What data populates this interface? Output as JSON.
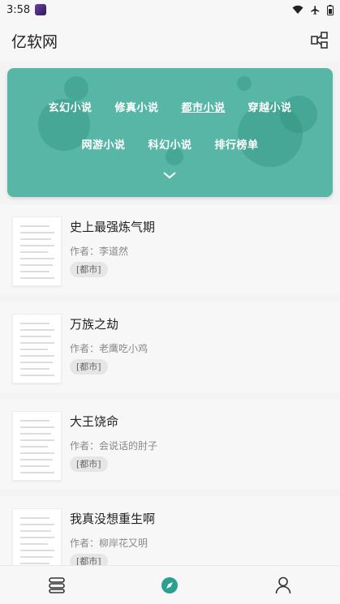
{
  "status": {
    "time": "3:58"
  },
  "app": {
    "title": "亿软网"
  },
  "categories": {
    "row1": [
      "玄幻小说",
      "修真小说",
      "都市小说",
      "穿越小说"
    ],
    "row2": [
      "网游小说",
      "科幻小说",
      "排行榜单"
    ],
    "active": "都市小说"
  },
  "colors": {
    "banner": "#58b6a6",
    "accent": "#2aa090"
  },
  "books": [
    {
      "title": "史上最强炼气期",
      "author": "作者：李道然",
      "tag": "[都市]"
    },
    {
      "title": "万族之劫",
      "author": "作者：老鹰吃小鸡",
      "tag": "[都市]"
    },
    {
      "title": "大王饶命",
      "author": "作者：会说话的肘子",
      "tag": "[都市]"
    },
    {
      "title": "我真没想重生啊",
      "author": "作者：柳岸花又明",
      "tag": "[都市]"
    }
  ],
  "nav": {
    "items": [
      {
        "icon": "bookshelf-icon"
      },
      {
        "icon": "compass-icon",
        "active": true
      },
      {
        "icon": "user-icon"
      }
    ]
  }
}
